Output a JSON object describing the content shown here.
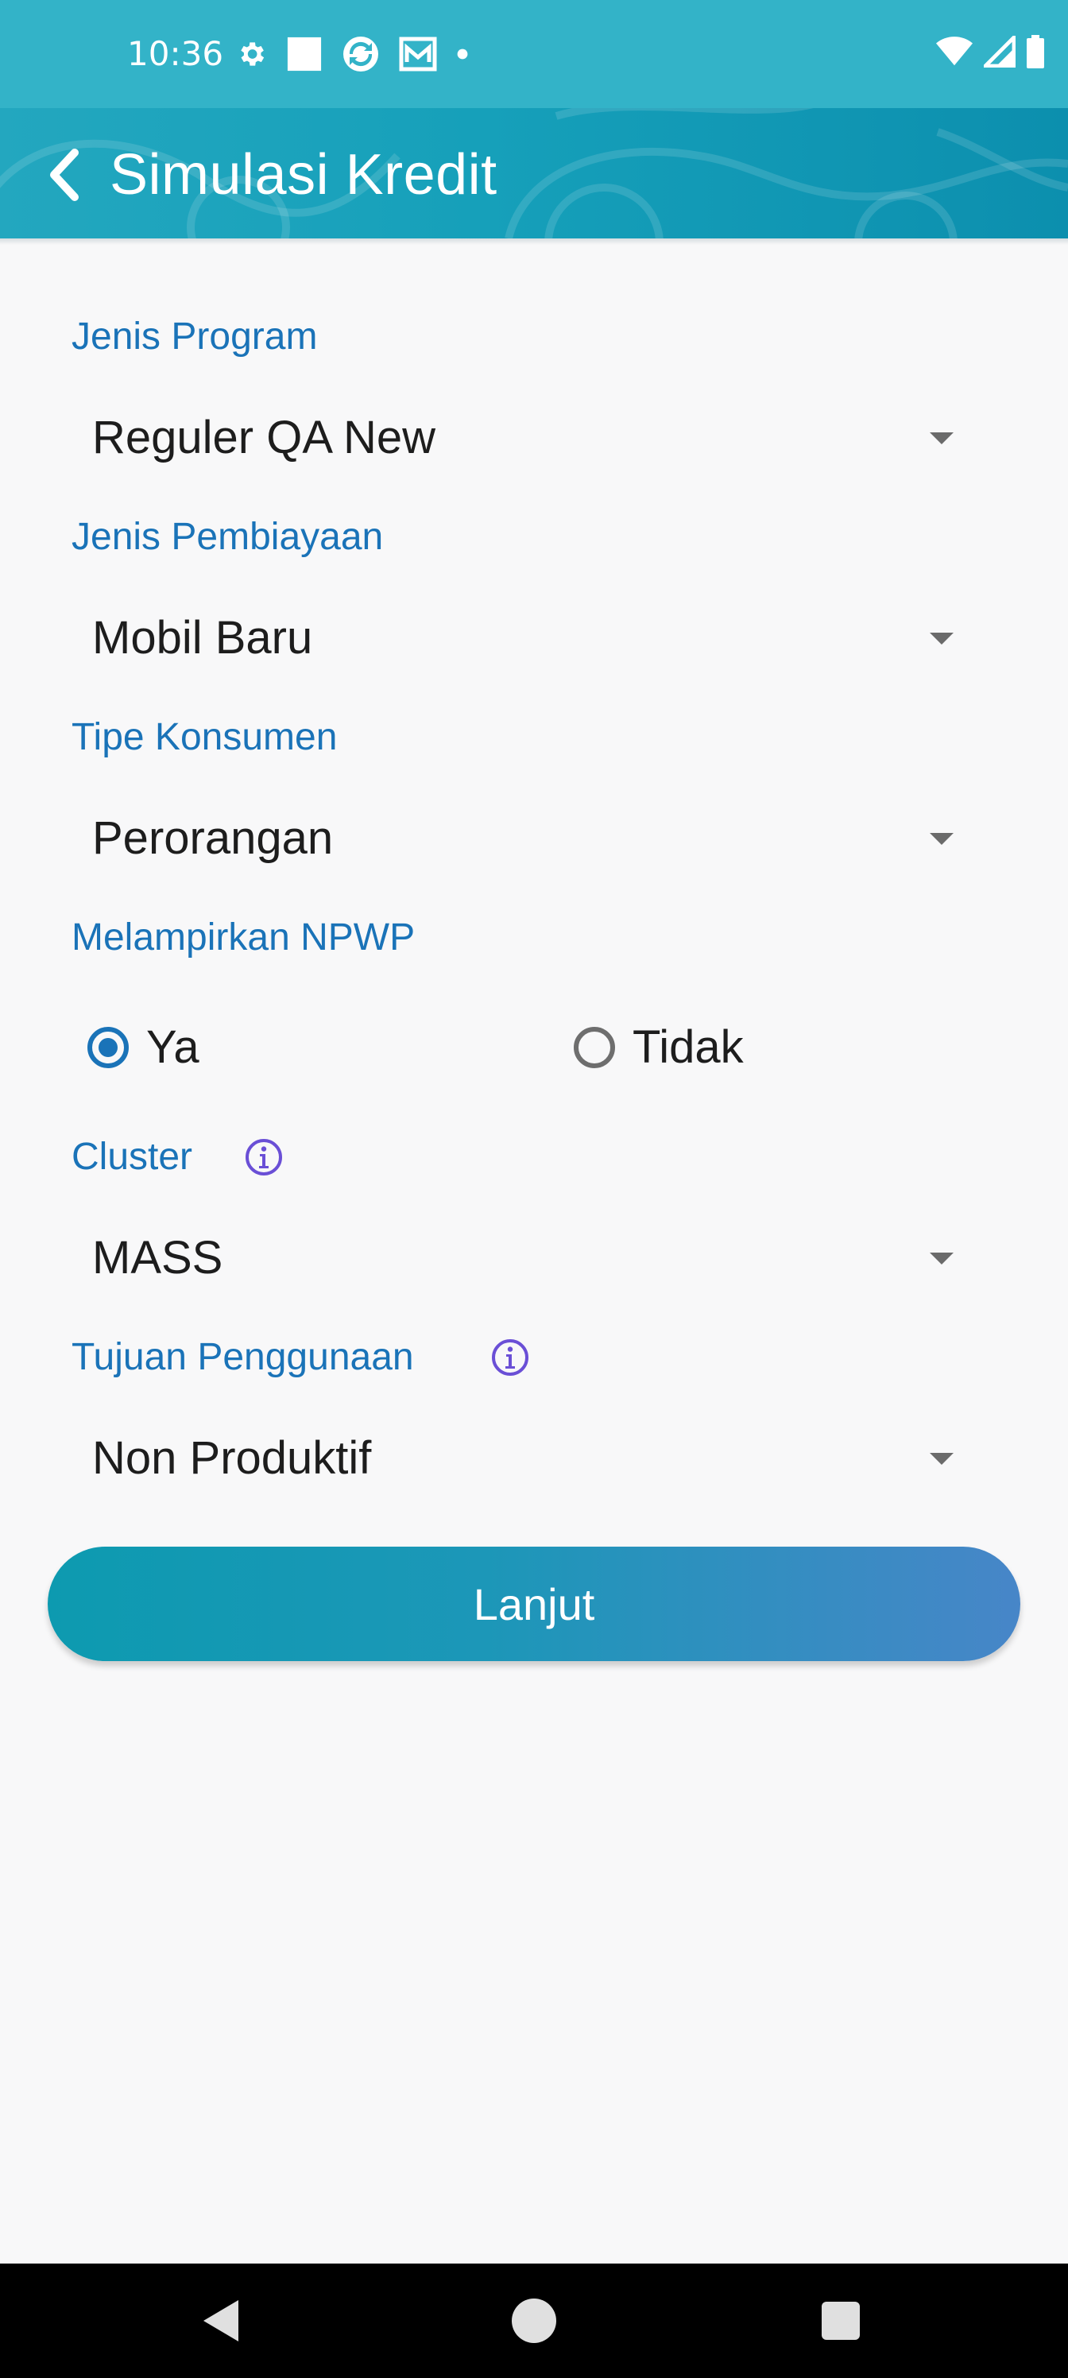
{
  "status_bar": {
    "time": "10:36",
    "left_icons": [
      "gear-icon",
      "square-icon",
      "sync-app-icon",
      "mail-icon",
      "dot-icon"
    ],
    "right_icons": [
      "wifi-icon",
      "signal-icon",
      "battery-icon"
    ]
  },
  "header": {
    "title": "Simulasi Kredit",
    "back_icon": "chevron-left-icon"
  },
  "form": {
    "jenis_program": {
      "label": "Jenis Program",
      "value": "Reguler QA New"
    },
    "jenis_pembiayaan": {
      "label": "Jenis Pembiayaan",
      "value": "Mobil Baru"
    },
    "tipe_konsumen": {
      "label": "Tipe Konsumen",
      "value": "Perorangan"
    },
    "npwp": {
      "label": "Melampirkan NPWP",
      "options": [
        "Ya",
        "Tidak"
      ],
      "selected": "Ya"
    },
    "cluster": {
      "label": "Cluster",
      "value": "MASS",
      "info_icon": "info-icon"
    },
    "tujuan_penggunaan": {
      "label": "Tujuan Penggunaan",
      "value": "Non Produktif",
      "info_icon": "info-icon"
    }
  },
  "actions": {
    "submit_label": "Lanjut"
  },
  "nav_bar": {
    "icons": [
      "back-triangle-icon",
      "home-circle-icon",
      "recents-square-icon"
    ]
  },
  "colors": {
    "accent": "#1a73b8",
    "header": "#16a0ba",
    "button_start": "#0d9ab0",
    "button_end": "#4786c8",
    "info_icon": "#6a4fd6"
  }
}
